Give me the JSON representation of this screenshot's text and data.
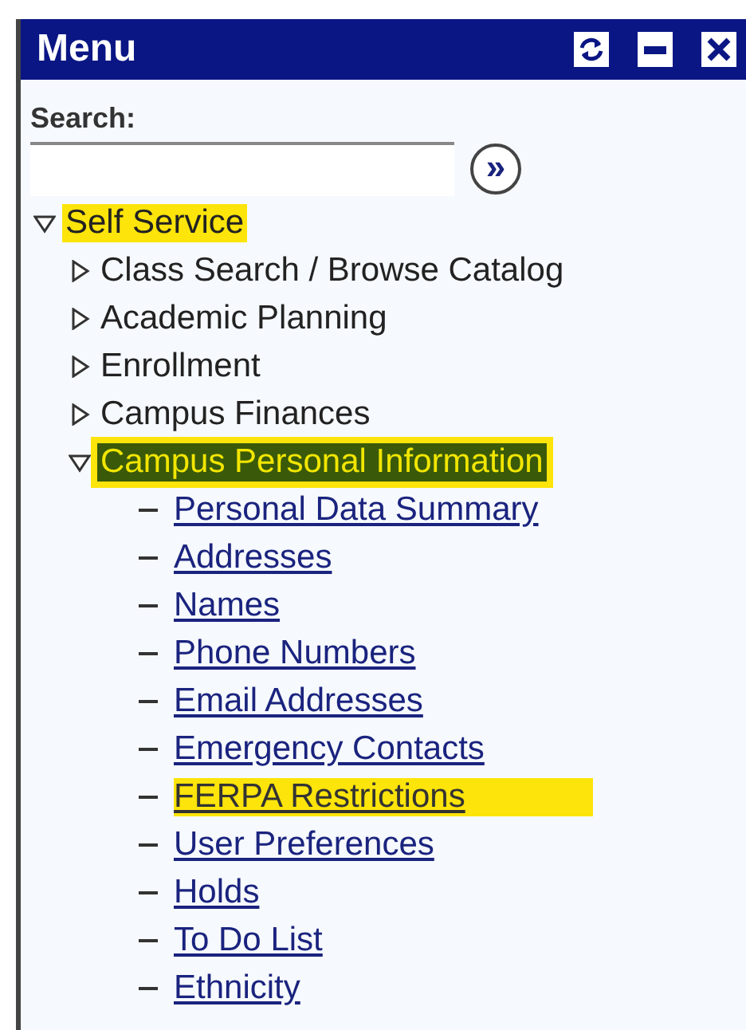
{
  "window": {
    "title": "Menu"
  },
  "search": {
    "label": "Search:",
    "go_symbol": "»"
  },
  "tree": [
    {
      "label": "Self Service",
      "kind": "folder",
      "expanded": true,
      "highlighted": true,
      "selected": false,
      "children": [
        {
          "label": "Class Search / Browse Catalog",
          "kind": "folder",
          "expanded": false,
          "highlighted": false,
          "selected": false
        },
        {
          "label": "Academic Planning",
          "kind": "folder",
          "expanded": false,
          "highlighted": false,
          "selected": false
        },
        {
          "label": "Enrollment",
          "kind": "folder",
          "expanded": false,
          "highlighted": false,
          "selected": false
        },
        {
          "label": "Campus Finances",
          "kind": "folder",
          "expanded": false,
          "highlighted": false,
          "selected": false
        },
        {
          "label": "Campus Personal Information",
          "kind": "folder",
          "expanded": true,
          "highlighted": true,
          "selected": true,
          "children": [
            {
              "label": "Personal Data Summary",
              "kind": "link",
              "highlighted": false,
              "selected": false
            },
            {
              "label": "Addresses",
              "kind": "link",
              "highlighted": false,
              "selected": false
            },
            {
              "label": "Names",
              "kind": "link",
              "highlighted": false,
              "selected": false
            },
            {
              "label": "Phone Numbers",
              "kind": "link",
              "highlighted": false,
              "selected": false
            },
            {
              "label": "Email Addresses",
              "kind": "link",
              "highlighted": false,
              "selected": false
            },
            {
              "label": "Emergency Contacts",
              "kind": "link",
              "highlighted": false,
              "selected": false
            },
            {
              "label": "FERPA Restrictions",
              "kind": "link",
              "highlighted": true,
              "selected": false
            },
            {
              "label": "User Preferences",
              "kind": "link",
              "highlighted": false,
              "selected": false
            },
            {
              "label": "Holds",
              "kind": "link",
              "highlighted": false,
              "selected": false
            },
            {
              "label": "To Do List",
              "kind": "link",
              "highlighted": false,
              "selected": false
            },
            {
              "label": "Ethnicity",
              "kind": "link",
              "highlighted": false,
              "selected": false
            }
          ]
        }
      ]
    }
  ]
}
